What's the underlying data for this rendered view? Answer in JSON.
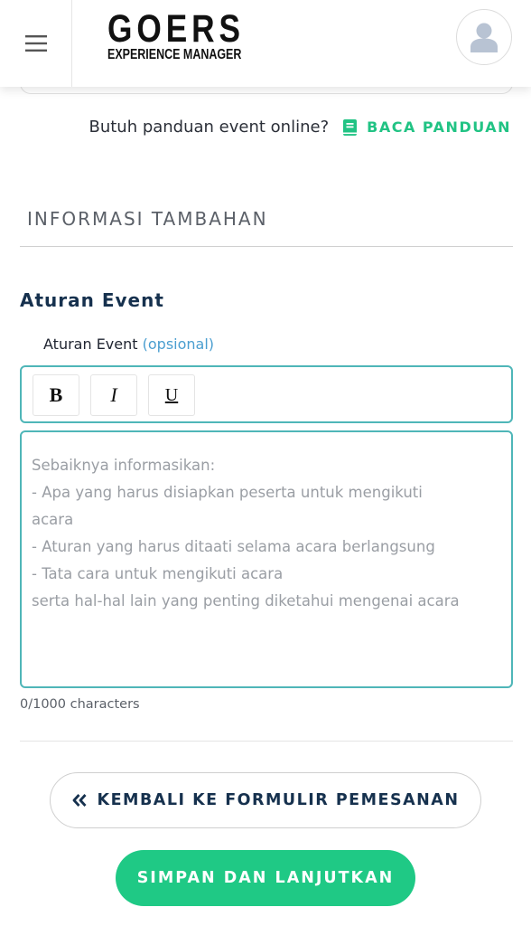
{
  "header": {
    "logo_main": "GOERS",
    "logo_sub": "EXPERIENCE MANAGER"
  },
  "guide": {
    "question": "Butuh panduan event online?",
    "link_label": "BACA PANDUAN"
  },
  "section": {
    "title": "INFORMASI TAMBAHAN"
  },
  "aturan": {
    "heading": "Aturan Event",
    "label": "Aturan Event",
    "optional": "(opsional)",
    "toolbar": {
      "bold": "B",
      "italic": "I",
      "underline": "U"
    },
    "placeholder_lines": [
      "Sebaiknya informasikan:",
      "- Apa yang harus disiapkan peserta untuk mengikuti",
      "acara",
      "- Aturan yang harus ditaati selama acara berlangsung",
      "- Tata cara untuk mengikuti acara",
      "serta hal-hal lain yang penting diketahui mengenai acara"
    ],
    "char_count": "0/1000 characters"
  },
  "buttons": {
    "back_label": "KEMBALI KE FORMULIR PEMESANAN",
    "save_label": "SIMPAN DAN LANJUTKAN"
  },
  "colors": {
    "accent_green": "#1fc985",
    "field_border_teal": "#4fb6b8",
    "heading_navy": "#16314e",
    "optional_blue": "#4a9ed0"
  },
  "icons": {
    "menu": "hamburger-menu-icon",
    "avatar": "user-avatar-icon",
    "guide": "book-icon",
    "back": "double-chevron-left-icon"
  }
}
